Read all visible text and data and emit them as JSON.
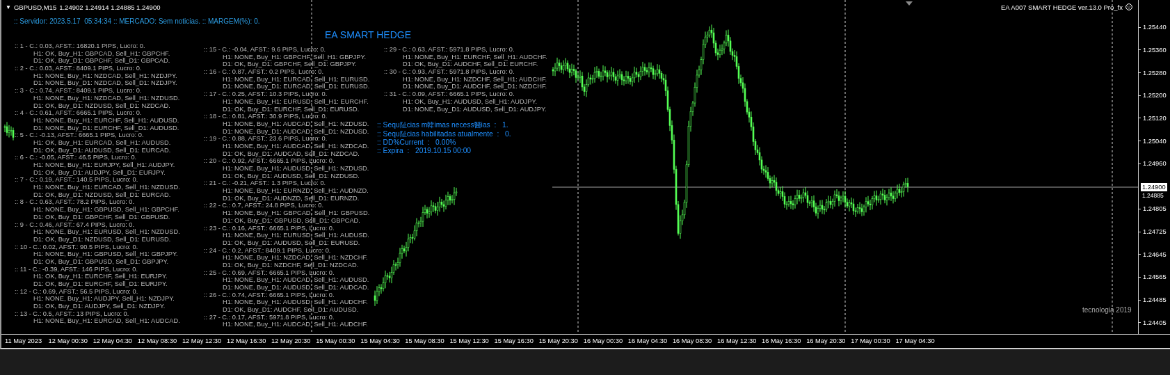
{
  "chart_header": {
    "menu_glyph": "▼",
    "symbol": "GBPUSD,M15",
    "quotes": "1.24902 1.24914 1.24885 1.24900"
  },
  "expert_label": "EA A007 SMART HEDGE ver.13.0 Pro_fx",
  "status_line": ":: Servidor: 2023.5.17  05:34:34 :: MERCADO: Sem noticias. :: MARGEM(%): 0.",
  "panel_title": "EA SMART HEDGE",
  "columns": [
    [
      {
        "summary": ":: 1 - C.: 0.03, AFST.: 16820.1 PIPS, Lucro: 0.",
        "h1": "H1: OK, Buy_H1: GBPCAD, Sell_H1: GBPCHF.",
        "d1": "D1: OK, Buy_D1: GBPCHF, Sell_D1: GBPCAD."
      },
      {
        "summary": ":: 2 - C.: 0.03, AFST.: 8409.1 PIPS, Lucro: 0.",
        "h1": "H1: NONE, Buy_H1: NZDCAD, Sell_H1: NZDJPY.",
        "d1": "D1: NONE, Buy_D1: NZDCAD, Sell_D1: NZDJPY."
      },
      {
        "summary": ":: 3 - C.: 0.74, AFST.: 8409.1 PIPS, Lucro: 0.",
        "h1": "H1: NONE, Buy_H1: NZDCAD, Sell_H1: NZDUSD.",
        "d1": "D1: OK, Buy_D1: NZDUSD, Sell_D1: NZDCAD."
      },
      {
        "summary": ":: 4 - C.: 0.61, AFST.: 6665.1 PIPS, Lucro: 0.",
        "h1": "H1: NONE, Buy_H1: EURCHF, Sell_H1: AUDUSD.",
        "d1": "D1: NONE, Buy_D1: EURCHF, Sell_D1: AUDUSD."
      },
      {
        "summary": ":: 5 - C.: -0.13, AFST.: 6665.1 PIPS, Lucro: 0.",
        "h1": "H1: OK, Buy_H1: EURCAD, Sell_H1: AUDUSD.",
        "d1": "D1: OK, Buy_D1: AUDUSD, Sell_D1: EURCAD."
      },
      {
        "summary": ":: 6 - C.: -0.05, AFST.: 46.5 PIPS, Lucro: 0.",
        "h1": "H1: NONE, Buy_H1: EURJPY, Sell_H1: AUDJPY.",
        "d1": "D1: OK, Buy_D1: AUDJPY, Sell_D1: EURJPY."
      },
      {
        "summary": ":: 7 - C.: 0.19, AFST.: 140.5 PIPS, Lucro: 0.",
        "h1": "H1: NONE, Buy_H1: EURCAD, Sell_H1: NZDUSD.",
        "d1": "D1: OK, Buy_D1: NZDUSD, Sell_D1: EURCAD."
      },
      {
        "summary": ":: 8 - C.: 0.63, AFST.: 78.2 PIPS, Lucro: 0.",
        "h1": "H1: NONE, Buy_H1: GBPUSD, Sell_H1: GBPCHF.",
        "d1": "D1: OK, Buy_D1: GBPCHF, Sell_D1: GBPUSD."
      },
      {
        "summary": ":: 9 - C.: 0.46, AFST.: 67.4 PIPS, Lucro: 0.",
        "h1": "H1: NONE, Buy_H1: EURUSD, Sell_H1: NZDUSD.",
        "d1": "D1: OK, Buy_D1: NZDUSD, Sell_D1: EURUSD."
      },
      {
        "summary": ":: 10 - C.: 0.02, AFST.: 90.5 PIPS, Lucro: 0.",
        "h1": "H1: NONE, Buy_H1: GBPUSD, Sell_H1: GBPJPY.",
        "d1": "D1: OK, Buy_D1: GBPUSD, Sell_D1: GBPJPY."
      },
      {
        "summary": ":: 11 - C.: -0.39, AFST.: 146 PIPS, Lucro: 0.",
        "h1": "H1: OK, Buy_H1: EURCHF, Sell_H1: EURJPY.",
        "d1": "D1: OK, Buy_D1: EURCHF, Sell_D1: EURJPY."
      },
      {
        "summary": ":: 12 - C.: 0.69, AFST.: 56.5 PIPS, Lucro: 0.",
        "h1": "H1: NONE, Buy_H1: AUDJPY, Sell_H1: NZDJPY.",
        "d1": "D1: OK, Buy_D1: AUDJPY, Sell_D1: NZDJPY."
      },
      {
        "summary": ":: 13 - C.: 0.5, AFST.: 13 PIPS, Lucro: 0.",
        "h1": "H1: NONE, Buy_H1: EURCAD, Sell_H1: AUDCAD."
      }
    ],
    [
      {
        "summary": ":: 15 - C.: -0.04, AFST.: 9.6 PIPS, Lucro: 0.",
        "h1": "H1: NONE, Buy_H1: GBPCHF, Sell_H1: GBPJPY.",
        "d1": "D1: OK, Buy_D1: GBPCHF, Sell_D1: GBPJPY."
      },
      {
        "summary": ":: 16 - C.: 0.87, AFST.: 0.2 PIPS, Lucro: 0.",
        "h1": "H1: NONE, Buy_H1: EURCAD, Sell_H1: EURUSD.",
        "d1": "D1: NONE, Buy_D1: EURCAD, Sell_D1: EURUSD."
      },
      {
        "summary": ":: 17 - C.: 0.25, AFST.: 10.3 PIPS, Lucro: 0.",
        "h1": "H1: NONE, Buy_H1: EURUSD, Sell_H1: EURCHF.",
        "d1": "D1: OK, Buy_D1: EURCHF, Sell_D1: EURUSD."
      },
      {
        "summary": ":: 18 - C.: 0.81, AFST.: 30.9 PIPS, Lucro: 0.",
        "h1": "H1: NONE, Buy_H1: AUDCAD, Sell_H1: NZDUSD.",
        "d1": "D1: NONE, Buy_D1: AUDCAD, Sell_D1: NZDUSD."
      },
      {
        "summary": ":: 19 - C.: 0.88, AFST.: 23.6 PIPS, Lucro: 0.",
        "h1": "H1: NONE, Buy_H1: AUDCAD, Sell_H1: NZDCAD.",
        "d1": "D1: OK, Buy_D1: AUDCAD, Sell_D1: NZDCAD."
      },
      {
        "summary": ":: 20 - C.: 0.92, AFST.: 6665.1 PIPS, Lucro: 0.",
        "h1": "H1: NONE, Buy_H1: AUDUSD, Sell_H1: NZDUSD.",
        "d1": "D1: OK, Buy_D1: AUDUSD, Sell_D1: NZDUSD."
      },
      {
        "summary": ":: 21 - C.: -0.21, AFST.: 1.3 PIPS, Lucro: 0.",
        "h1": "H1: NONE, Buy_H1: EURNZD, Sell_H1: AUDNZD.",
        "d1": "D1: OK, Buy_D1: AUDNZD, Sell_D1: EURNZD."
      },
      {
        "summary": ":: 22 - C.: 0.7, AFST.: 24.8 PIPS, Lucro: 0.",
        "h1": "H1: NONE, Buy_H1: GBPCAD, Sell_H1: GBPUSD.",
        "d1": "D1: OK, Buy_D1: GBPUSD, Sell_D1: GBPCAD."
      },
      {
        "summary": ":: 23 - C.: 0.16, AFST.: 6665.1 PIPS, Lucro: 0.",
        "h1": "H1: NONE, Buy_H1: EURUSD, Sell_H1: AUDUSD.",
        "d1": "D1: OK, Buy_D1: AUDUSD, Sell_D1: EURUSD."
      },
      {
        "summary": ":: 24 - C.: 0.2, AFST.: 8409.1 PIPS, Lucro: 0.",
        "h1": "H1: NONE, Buy_H1: NZDCAD, Sell_H1: NZDCHF.",
        "d1": "D1: OK, Buy_D1: NZDCHF, Sell_D1: NZDCAD."
      },
      {
        "summary": ":: 25 - C.: 0.69, AFST.: 6665.1 PIPS, Lucro: 0.",
        "h1": "H1: NONE, Buy_H1: AUDCAD, Sell_H1: AUDUSD.",
        "d1": "D1: NONE, Buy_D1: AUDUSD, Sell_D1: AUDCAD."
      },
      {
        "summary": ":: 26 - C.: 0.74, AFST.: 6665.1 PIPS, Lucro: 0.",
        "h1": "H1: NONE, Buy_H1: AUDUSD, Sell_H1: AUDCHF.",
        "d1": "D1: OK, Buy_D1: AUDCHF, Sell_D1: AUDUSD."
      },
      {
        "summary": ":: 27 - C.: 0.17, AFST.: 5971.8 PIPS, Lucro: 0.",
        "h1": "H1: NONE, Buy_H1: AUDCAD, Sell_H1: AUDCHF."
      }
    ],
    [
      {
        "summary": ":: 29 - C.: 0.63, AFST.: 5971.8 PIPS, Lucro: 0.",
        "h1": "H1: NONE, Buy_H1: EURCHF, Sell_H1: AUDCHF.",
        "d1": "D1: OK, Buy_D1: AUDCHF, Sell_D1: EURCHF."
      },
      {
        "summary": ":: 30 - C.: 0.93, AFST.: 5971.8 PIPS, Lucro: 0.",
        "h1": "H1: NONE, Buy_H1: NZDCHF, Sell_H1: AUDCHF.",
        "d1": "D1: NONE, Buy_D1: AUDCHF, Sell_D1: NZDCHF."
      },
      {
        "summary": ":: 31 - C.: 0.09, AFST.: 6665.1 PIPS, Lucro: 0.",
        "h1": "H1: OK, Buy_H1: AUDUSD, Sell_H1: AUDJPY.",
        "d1": "D1: NONE, Buy_D1: AUDUSD, Sell_D1: AUDJPY."
      }
    ]
  ],
  "stats": [
    ":: Sequ阯cias m韓imas necess醫ias  :   1.",
    ":: Sequ阯cias habilitadas atualmente  :   0.",
    ":: DD%Current  :   0.00%",
    ":: Expira  :   2019.10.15 00:00"
  ],
  "footer_label": "tecnologia 2019",
  "price_axis": {
    "labels": [
      "1.25440",
      "1.25360",
      "1.25280",
      "1.25200",
      "1.25120",
      "1.25040",
      "1.24960",
      "1.24805",
      "1.24725",
      "1.24645",
      "1.24565",
      "1.24485",
      "1.24405"
    ],
    "bid": "1.24900",
    "under_bid": "1.24885"
  },
  "time_axis": [
    "11 May 2023",
    "12 May 00:30",
    "12 May 04:30",
    "12 May 08:30",
    "12 May 12:30",
    "12 May 16:30",
    "12 May 20:30",
    "15 May 00:30",
    "15 May 04:30",
    "15 May 08:30",
    "15 May 12:30",
    "15 May 16:30",
    "15 May 20:30",
    "16 May 00:30",
    "16 May 04:30",
    "16 May 08:30",
    "16 May 12:30",
    "16 May 16:30",
    "16 May 20:30",
    "17 May 00:30",
    "17 May 04:30"
  ]
}
